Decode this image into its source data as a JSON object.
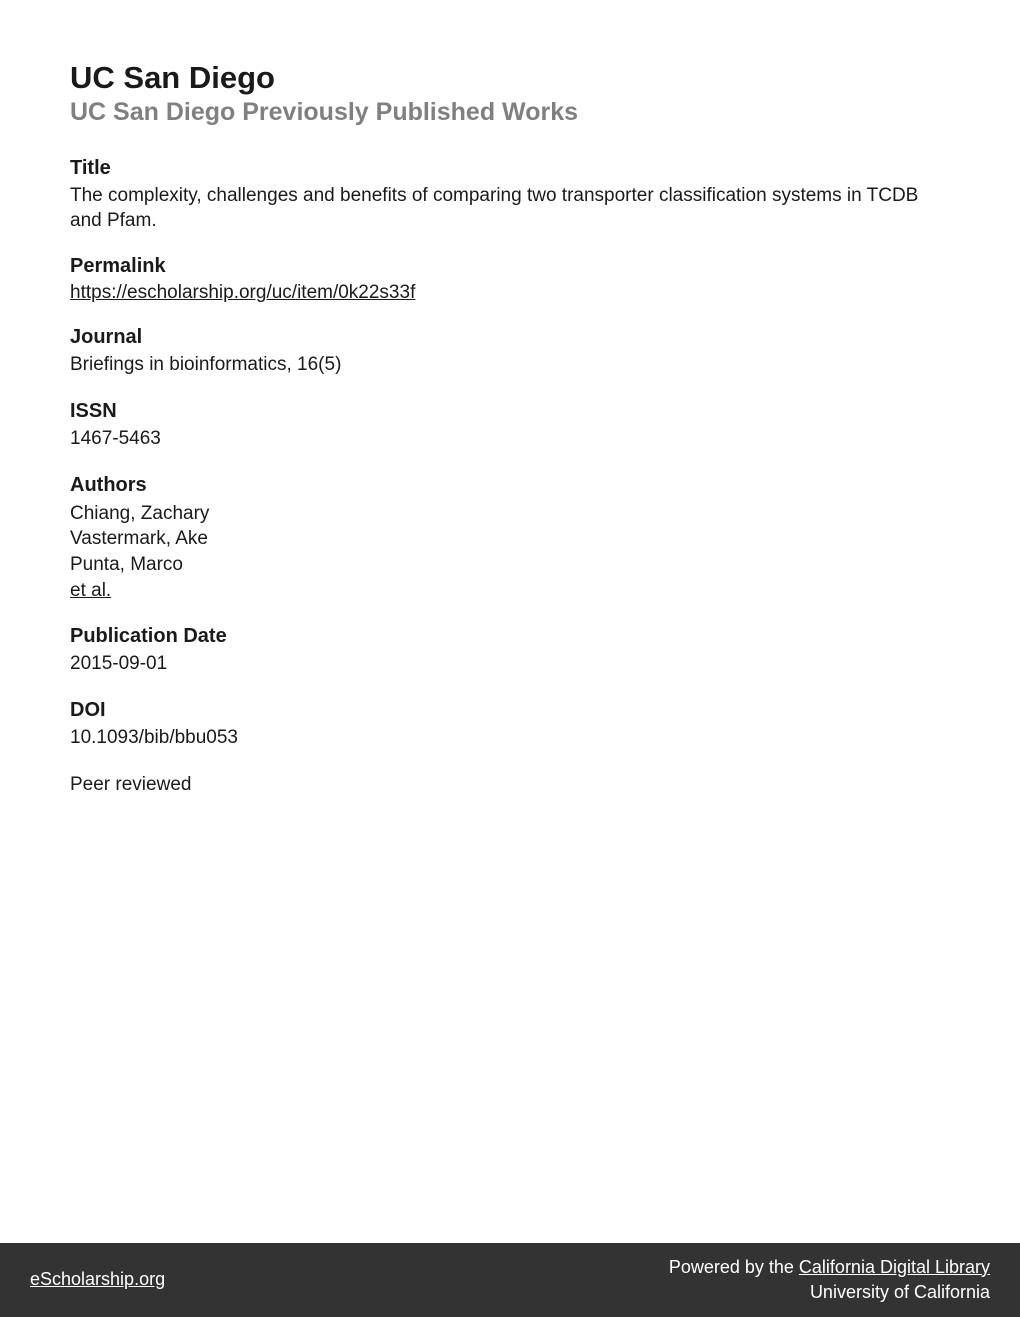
{
  "header": {
    "institution": "UC San Diego",
    "collection": "UC San Diego Previously Published Works"
  },
  "sections": {
    "title": {
      "label": "Title",
      "text": "The complexity, challenges and benefits of comparing two transporter classification systems in TCDB and Pfam."
    },
    "permalink": {
      "label": "Permalink",
      "url": "https://escholarship.org/uc/item/0k22s33f"
    },
    "journal": {
      "label": "Journal",
      "text": "Briefings in bioinformatics, 16(5)"
    },
    "issn": {
      "label": "ISSN",
      "text": "1467-5463"
    },
    "authors": {
      "label": "Authors",
      "list": [
        "Chiang, Zachary",
        "Vastermark, Ake",
        "Punta, Marco"
      ],
      "etal": "et al."
    },
    "publication_date": {
      "label": "Publication Date",
      "text": "2015-09-01"
    },
    "doi": {
      "label": "DOI",
      "text": "10.1093/bib/bbu053"
    },
    "peer_reviewed": {
      "text": "Peer reviewed"
    }
  },
  "footer": {
    "left": "eScholarship.org",
    "right_prefix": "Powered by the ",
    "right_link": "California Digital Library",
    "right_line2": "University of California"
  }
}
